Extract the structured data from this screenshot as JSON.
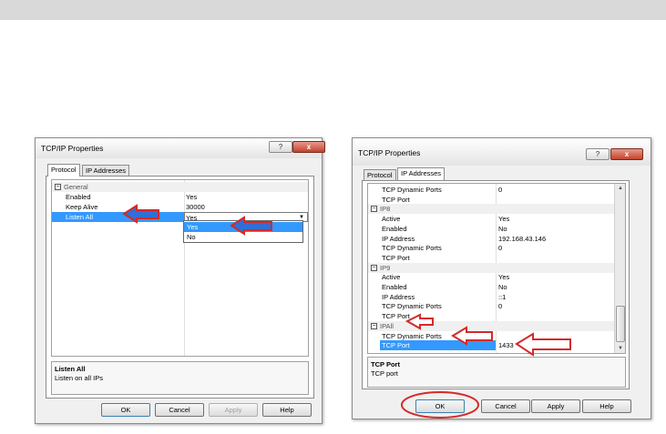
{
  "dialog_left": {
    "title": "TCP/IP Properties",
    "help_glyph": "?",
    "close_glyph": "x",
    "tabs": [
      {
        "label": "Protocol"
      },
      {
        "label": "IP Addresses"
      }
    ],
    "category": "General",
    "rows": [
      {
        "key": "Enabled",
        "value": "Yes"
      },
      {
        "key": "Keep Alive",
        "value": "30000"
      },
      {
        "key": "Listen All",
        "value": "Yes"
      }
    ],
    "dropdown_options": [
      "Yes",
      "No"
    ],
    "dropdown_selected": "Yes",
    "description": {
      "title": "Listen All",
      "text": "Listen on all IPs"
    },
    "buttons": {
      "ok": "OK",
      "cancel": "Cancel",
      "apply": "Apply",
      "help": "Help"
    }
  },
  "dialog_right": {
    "title": "TCP/IP Properties",
    "help_glyph": "?",
    "close_glyph": "x",
    "tabs": [
      {
        "label": "Protocol"
      },
      {
        "label": "IP Addresses"
      }
    ],
    "rows": [
      {
        "key": "TCP Dynamic Ports",
        "value": "0"
      },
      {
        "key": "TCP Port",
        "value": ""
      },
      {
        "cat": "IP8"
      },
      {
        "key": "Active",
        "value": "Yes"
      },
      {
        "key": "Enabled",
        "value": "No"
      },
      {
        "key": "IP Address",
        "value": "192.168.43.146"
      },
      {
        "key": "TCP Dynamic Ports",
        "value": "0"
      },
      {
        "key": "TCP Port",
        "value": ""
      },
      {
        "cat": "IP9"
      },
      {
        "key": "Active",
        "value": "Yes"
      },
      {
        "key": "Enabled",
        "value": "No"
      },
      {
        "key": "IP Address",
        "value": "::1"
      },
      {
        "key": "TCP Dynamic Ports",
        "value": "0"
      },
      {
        "key": "TCP Port",
        "value": ""
      },
      {
        "cat": "IPAll"
      },
      {
        "key": "TCP Dynamic Ports",
        "value": ""
      },
      {
        "key": "TCP Port",
        "value": "1433"
      }
    ],
    "description": {
      "title": "TCP Port",
      "text": "TCP port"
    },
    "buttons": {
      "ok": "OK",
      "cancel": "Cancel",
      "apply": "Apply",
      "help": "Help"
    }
  },
  "colors": {
    "selection": "#3399ff",
    "annotation": "#d42a2a",
    "arrow_fill_blue": "#2f6fd6"
  }
}
